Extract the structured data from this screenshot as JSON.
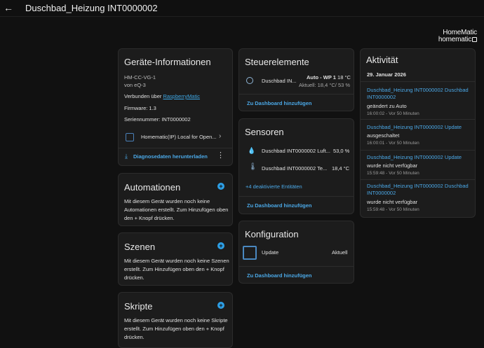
{
  "header": {
    "title": "Duschbad_Heizung INT0000002"
  },
  "logo": {
    "line1": "HomeMatic",
    "line2": "homematic"
  },
  "device_info": {
    "title": "Geräte-Informationen",
    "model": "HM-CC-VG-1",
    "manufacturer": "von eQ-3",
    "connected_prefix": "Verbunden über ",
    "connected_link": "RaspberryMatic",
    "firmware": "Firmware: 1.3",
    "serial": "Seriennummer: INT0000002",
    "integration": "Homematic(IP) Local for Open...",
    "download": "Diagnosedaten herunterladen"
  },
  "automations": {
    "title": "Automationen",
    "text": "Mit diesem Gerät wurden noch keine Automationen erstellt. Zum Hinzufügen oben den + Knopf drücken."
  },
  "scenes": {
    "title": "Szenen",
    "text": "Mit diesem Gerät wurden noch keine Szenen erstellt. Zum Hinzufügen oben den + Knopf drücken."
  },
  "scripts": {
    "title": "Skripte",
    "text": "Mit diesem Gerät wurden noch keine Skripte erstellt. Zum Hinzufügen oben den + Knopf drücken."
  },
  "controls": {
    "title": "Steuerelemente",
    "entity": "Duschbad IN...",
    "mode": "Auto - WP 1",
    "target": "18 °C",
    "current": "Aktuell: 18,4 °C/ 53 %",
    "add": "Zu Dashboard hinzufügen"
  },
  "sensors": {
    "title": "Sensoren",
    "rows": [
      {
        "name": "Duschbad INT0000002 Luft...",
        "value": "53,0 %",
        "icon": "humidity-icon"
      },
      {
        "name": "Duschbad INT0000002 Te...",
        "value": "18,4 °C",
        "icon": "thermometer-icon"
      }
    ],
    "disabled": "+4 deaktivierte Entitäten",
    "add": "Zu Dashboard hinzufügen"
  },
  "config": {
    "title": "Konfiguration",
    "name": "Update",
    "value": "Aktuell",
    "add": "Zu Dashboard hinzufügen"
  },
  "activity": {
    "title": "Aktivität",
    "date": "29. Januar 2026",
    "items": [
      {
        "link": "Duschbad_Heizung INT0000002 Duschbad INT0000002",
        "msg": "geändert zu Auto",
        "time": "16:00:02 - Vor 50 Minuten"
      },
      {
        "link": "Duschbad_Heizung INT0000002 Update",
        "msg": "ausgeschaltet",
        "time": "16:00:01 - Vor 50 Minuten"
      },
      {
        "link": "Duschbad_Heizung INT0000002 Update",
        "msg": "wurde nicht verfügbar",
        "time": "15:59:48 - Vor 50 Minuten"
      },
      {
        "link": "Duschbad_Heizung INT0000002 Duschbad INT0000002",
        "msg": "wurde nicht verfügbar",
        "time": "15:59:48 - Vor 50 Minuten"
      }
    ]
  }
}
